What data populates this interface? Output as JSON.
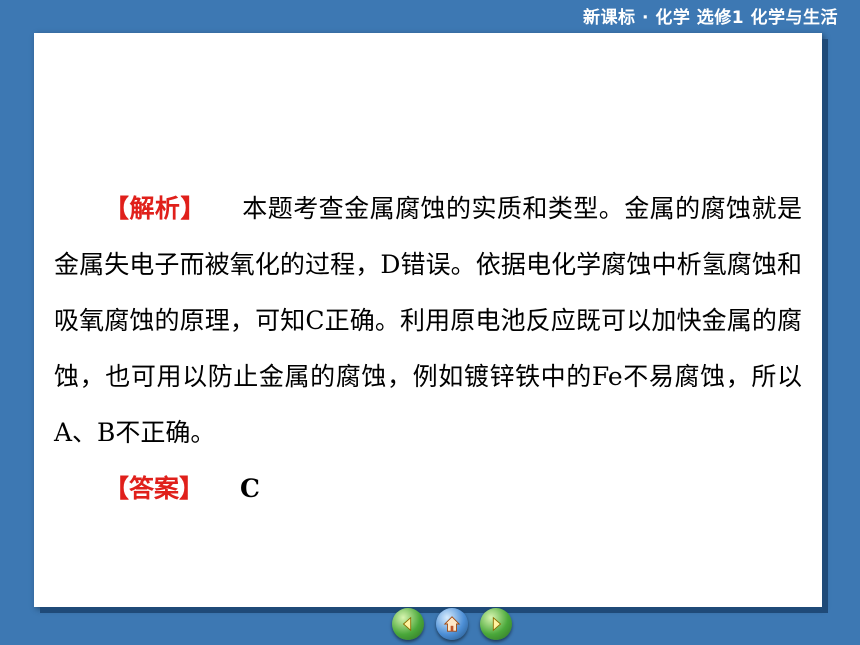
{
  "header": {
    "title": "新课标 · 化学  选修1  化学与生活"
  },
  "analysis": {
    "tag": "【解析】",
    "text": "本题考查金属腐蚀的实质和类型。金属的腐蚀就是金属失电子而被氧化的过程，D错误。依据电化学腐蚀中析氢腐蚀和吸氧腐蚀的原理，可知C正确。利用原电池反应既可以加快金属的腐蚀，也可用以防止金属的腐蚀，例如镀锌铁中的Fe不易腐蚀，所以A、B不正确。"
  },
  "answer": {
    "tag": "【答案】",
    "value": "C"
  },
  "nav": {
    "prev_icon": "arrow-left-icon",
    "home_icon": "home-icon",
    "next_icon": "arrow-right-icon"
  }
}
